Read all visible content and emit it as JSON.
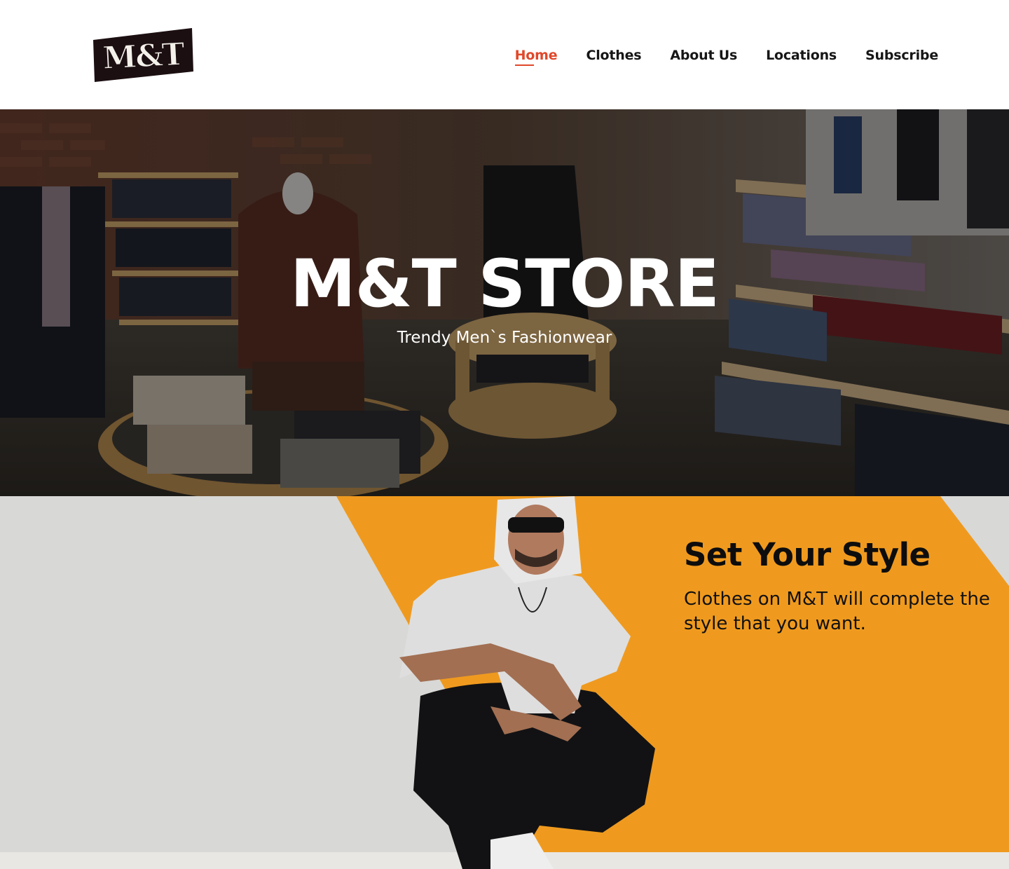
{
  "brand": {
    "logo_text": "M&T",
    "logo_bg": "#1c0f12",
    "logo_fg": "#f4f1ea"
  },
  "nav": {
    "items": [
      {
        "label": "Home",
        "active": true
      },
      {
        "label": "Clothes",
        "active": false
      },
      {
        "label": "About Us",
        "active": false
      },
      {
        "label": "Locations",
        "active": false
      },
      {
        "label": "Subscribe",
        "active": false
      }
    ],
    "active_color": "#e0482a",
    "text_color": "#161616"
  },
  "hero": {
    "title": "M&T STORE",
    "subtitle": "Trendy Men`s Fashionwear",
    "image": "store-interior-photo"
  },
  "style_section": {
    "heading": "Set Your Style",
    "text": "Clothes on M&T will complete the style that you want.",
    "image": "man-in-hoodie-photo",
    "accent_color": "#ef9a1f",
    "wall_color": "#d9d9d8"
  }
}
